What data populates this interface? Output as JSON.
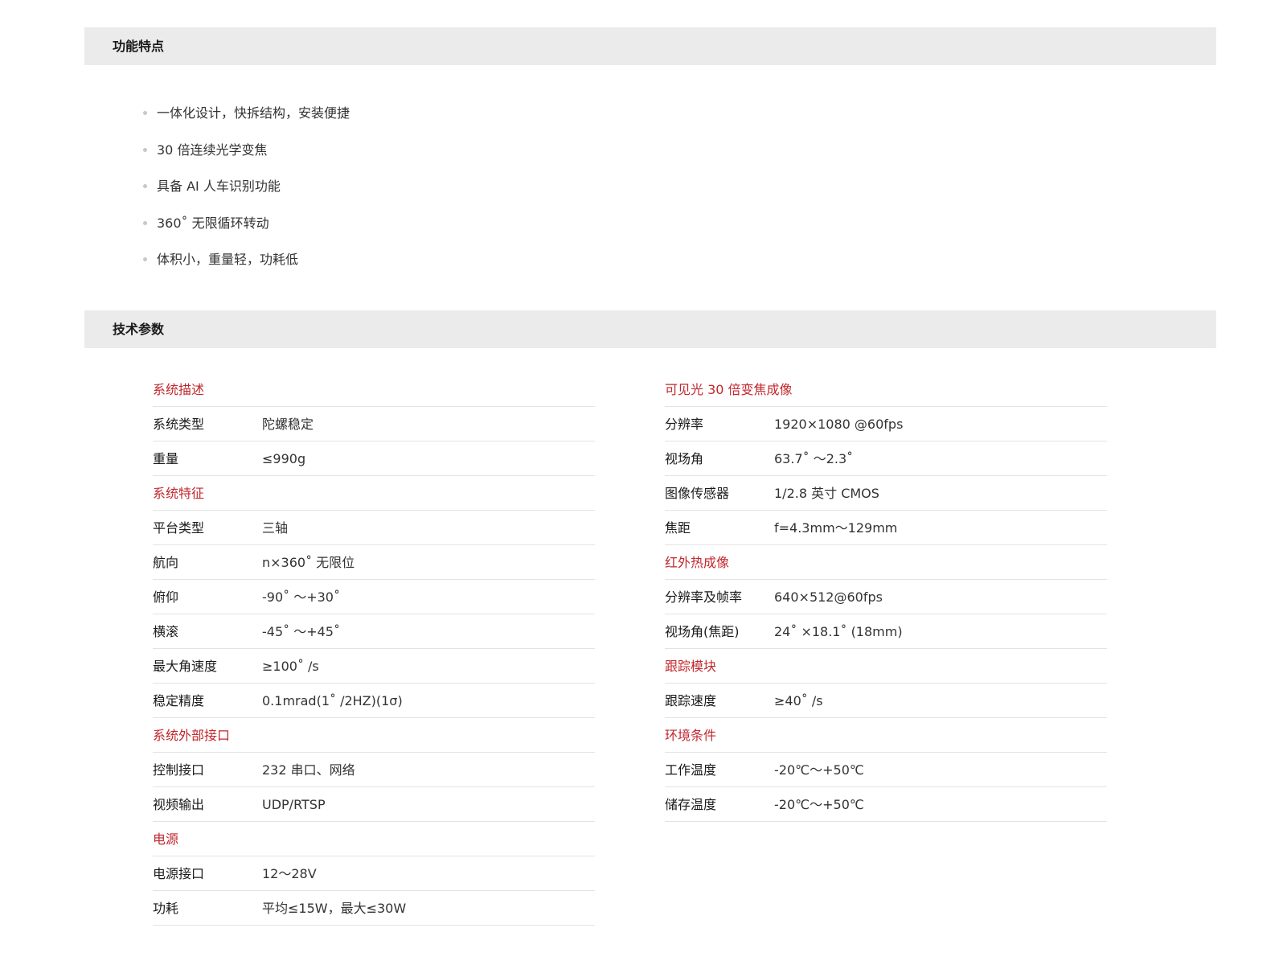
{
  "features_section": {
    "title": "功能特点",
    "items": [
      "一体化设计，快拆结构，安装便捷",
      "30 倍连续光学变焦",
      "具备 AI 人车识别功能",
      "360˚ 无限循环转动",
      "体积小，重量轻，功耗低"
    ]
  },
  "specs_section": {
    "title": "技术参数",
    "left": [
      {
        "type": "head",
        "label": "系统描述"
      },
      {
        "type": "row",
        "label": "系统类型",
        "value": "陀螺稳定"
      },
      {
        "type": "row",
        "label": "重量",
        "value": "≤990g"
      },
      {
        "type": "head",
        "label": "系统特征"
      },
      {
        "type": "row",
        "label": "平台类型",
        "value": "三轴"
      },
      {
        "type": "row",
        "label": "航向",
        "value": "n×360˚ 无限位"
      },
      {
        "type": "row",
        "label": "俯仰",
        "value": "-90˚ ～+30˚"
      },
      {
        "type": "row",
        "label": "横滚",
        "value": "-45˚ ～+45˚"
      },
      {
        "type": "row",
        "label": "最大角速度",
        "value": "≥100˚ /s"
      },
      {
        "type": "row",
        "label": "稳定精度",
        "value": "0.1mrad(1˚ /2HZ)(1σ)"
      },
      {
        "type": "head",
        "label": "系统外部接口"
      },
      {
        "type": "row",
        "label": "控制接口",
        "value": "232 串口、网络"
      },
      {
        "type": "row",
        "label": "视频输出",
        "value": "UDP/RTSP"
      },
      {
        "type": "head",
        "label": "电源"
      },
      {
        "type": "row",
        "label": "电源接口",
        "value": "12～28V"
      },
      {
        "type": "row",
        "label": "功耗",
        "value": "平均≤15W，最大≤30W"
      }
    ],
    "right": [
      {
        "type": "head",
        "label": "可见光 30 倍变焦成像"
      },
      {
        "type": "row",
        "label": "分辨率",
        "value": "1920×1080 @60fps"
      },
      {
        "type": "row",
        "label": "视场角",
        "value": "63.7˚ ～2.3˚"
      },
      {
        "type": "row",
        "label": "图像传感器",
        "value": "1/2.8 英寸 CMOS"
      },
      {
        "type": "row",
        "label": "焦距",
        "value": "f=4.3mm～129mm"
      },
      {
        "type": "head",
        "label": "红外热成像"
      },
      {
        "type": "row",
        "label": "分辨率及帧率",
        "value": "640×512@60fps"
      },
      {
        "type": "row",
        "label": "视场角(焦距)",
        "value": "24˚ ×18.1˚ (18mm)"
      },
      {
        "type": "head",
        "label": "跟踪模块"
      },
      {
        "type": "row",
        "label": "跟踪速度",
        "value": "≥40˚ /s"
      },
      {
        "type": "head",
        "label": "环境条件"
      },
      {
        "type": "row",
        "label": "工作温度",
        "value": "-20℃～+50℃"
      },
      {
        "type": "row",
        "label": "储存温度",
        "value": "-20℃～+50℃"
      }
    ]
  },
  "colors": {
    "section_bar": "#ebebeb",
    "category_head": "#c1272d",
    "row_divider": "#e3e3e3",
    "bullet": "#c8c8c8"
  }
}
